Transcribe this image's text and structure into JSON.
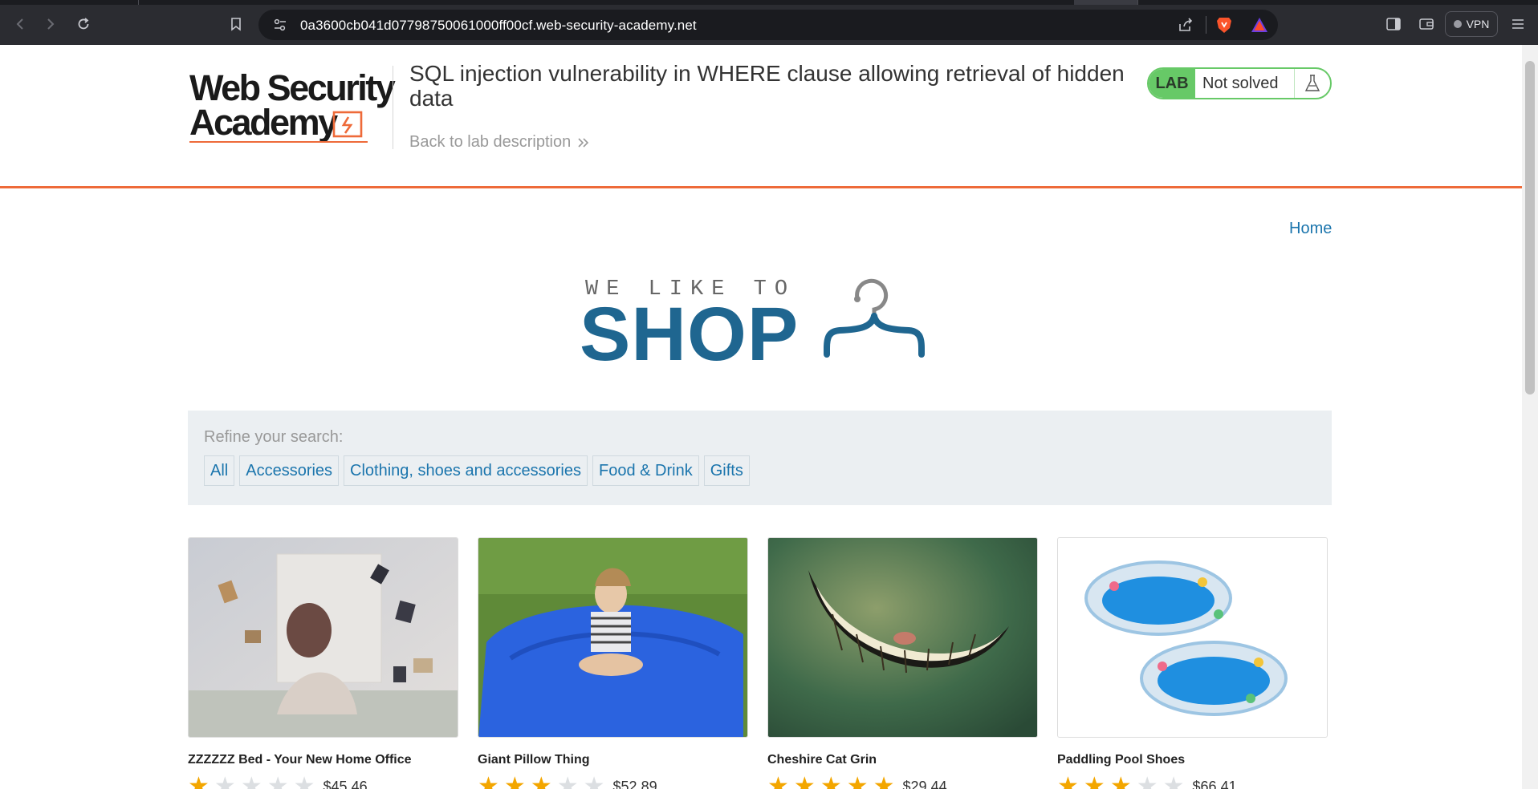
{
  "browser": {
    "url": "0a3600cb041d07798750061000ff00cf.web-security-academy.net",
    "vpn_label": "VPN"
  },
  "lab": {
    "logo_line1": "Web Security",
    "logo_line2": "Academy",
    "title": "SQL injection vulnerability in WHERE clause allowing retrieval of hidden data",
    "back_link": "Back to lab description",
    "status_tag": "LAB",
    "status_text": "Not solved"
  },
  "nav": {
    "home": "Home"
  },
  "shop_logo": {
    "tagline": "WE LIKE TO",
    "word": "SHOP"
  },
  "filters": {
    "label": "Refine your search:",
    "categories": [
      "All",
      "Accessories",
      "Clothing, shoes and accessories",
      "Food & Drink",
      "Gifts"
    ]
  },
  "products": [
    {
      "name": "ZZZZZZ Bed - Your New Home Office",
      "rating": 1,
      "price": "$45.46"
    },
    {
      "name": "Giant Pillow Thing",
      "rating": 3,
      "price": "$52.89"
    },
    {
      "name": "Cheshire Cat Grin",
      "rating": 5,
      "price": "$29.44"
    },
    {
      "name": "Paddling Pool Shoes",
      "rating": 3,
      "price": "$66.41"
    }
  ],
  "colors": {
    "accent_orange": "#ee6a39",
    "link_blue": "#1b75ad",
    "lab_green": "#67c967",
    "star_gold": "#f3a600",
    "shop_blue": "#1f6690"
  }
}
